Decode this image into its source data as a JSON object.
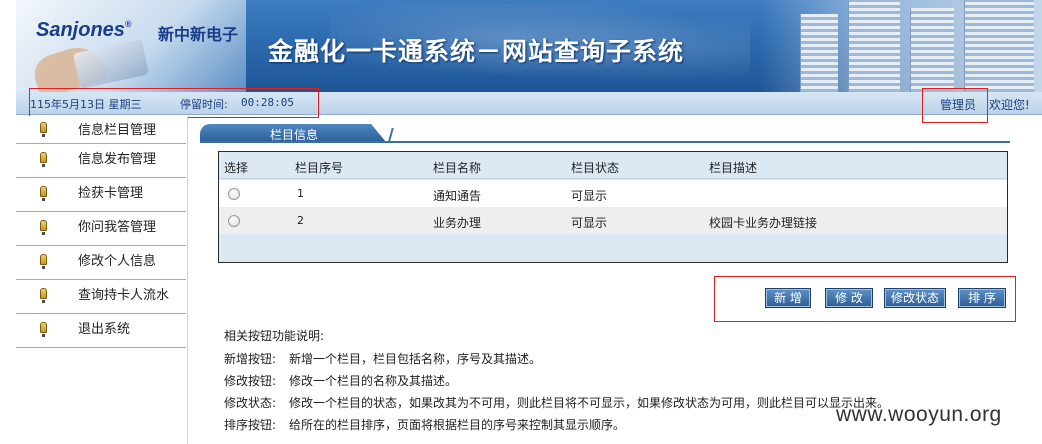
{
  "banner": {
    "logo_text": "Sanjones",
    "logo_reg": "®",
    "logo_cn": "新中新电子",
    "title": "金融化一卡通系统－网站查询子系统"
  },
  "status": {
    "date": "115年5月13日 星期三",
    "stay_label": "停留时间:",
    "stay_value": "00:28:05",
    "user_role": "管理员",
    "welcome": "欢迎您!"
  },
  "sidebar": {
    "items": [
      {
        "label": "信息栏目管理"
      },
      {
        "label": "信息发布管理"
      },
      {
        "label": "捡获卡管理"
      },
      {
        "label": "你问我答管理"
      },
      {
        "label": "修改个人信息"
      },
      {
        "label": "查询持卡人流水"
      },
      {
        "label": "退出系统"
      }
    ]
  },
  "tab": {
    "label": "栏目信息"
  },
  "table": {
    "headers": [
      "选择",
      "栏目序号",
      "栏目名称",
      "栏目状态",
      "栏目描述"
    ],
    "rows": [
      {
        "seq": "1",
        "name": "通知通告",
        "status": "可显示",
        "desc": ""
      },
      {
        "seq": "2",
        "name": "业务办理",
        "status": "可显示",
        "desc": "校园卡业务办理链接"
      }
    ]
  },
  "buttons": {
    "add": "新 增",
    "edit": "修 改",
    "edit_status": "修改状态",
    "sort": "排 序"
  },
  "help": {
    "title": "相关按钮功能说明:",
    "lines": [
      {
        "key": "新增按钮:",
        "text": "新增一个栏目，栏目包括名称，序号及其描述。"
      },
      {
        "key": "修改按钮:",
        "text": "修改一个栏目的名称及其描述。"
      },
      {
        "key": "修改状态:",
        "text": "修改一个栏目的状态，如果改其为不可用，则此栏目将不可显示，如果修改状态为可用，则此栏目可以显示出来。"
      },
      {
        "key": "排序按钮:",
        "text": "给所在的栏目排序，页面将根据栏目的序号来控制其显示顺序。"
      }
    ]
  },
  "watermark": "www.wooyun.org",
  "colors": {
    "banner_blue": "#2d6bb0",
    "button_blue": "#2d5e95",
    "highlight_red": "#e02020"
  }
}
